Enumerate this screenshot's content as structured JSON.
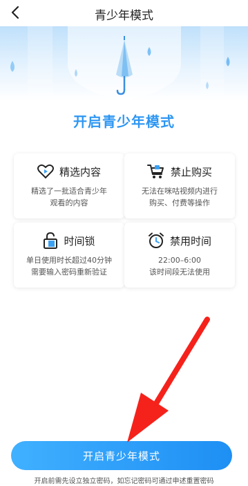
{
  "header": {
    "title": "青少年模式",
    "back_icon": "chevron-left-icon"
  },
  "subtitle": "开启青少年模式",
  "features": [
    {
      "icon": "heart-play-icon",
      "title": "精选内容",
      "desc": [
        "精选了一批适合青少年",
        "观看的内容"
      ]
    },
    {
      "icon": "shopping-cart-icon",
      "title": "禁止购买",
      "desc": [
        "无法在咪咕视频内进行",
        "购买、付费等操作"
      ]
    },
    {
      "icon": "lock-icon",
      "title": "时间锁",
      "desc": [
        "单日使用时长超过40分钟",
        "需要输入密码重新验证"
      ]
    },
    {
      "icon": "alarm-clock-icon",
      "title": "禁用时间",
      "desc": [
        "22:00–6:00",
        "该时间段无法使用"
      ]
    }
  ],
  "primary_button": "开启青少年模式",
  "footnote": "开启前需先设立独立密码，如忘记密码可通过申述重置密码",
  "colors": {
    "accent": "#2d96f2",
    "button_start": "#40b0ff",
    "button_end": "#1e8ff4",
    "arrow": "#f5221b"
  }
}
